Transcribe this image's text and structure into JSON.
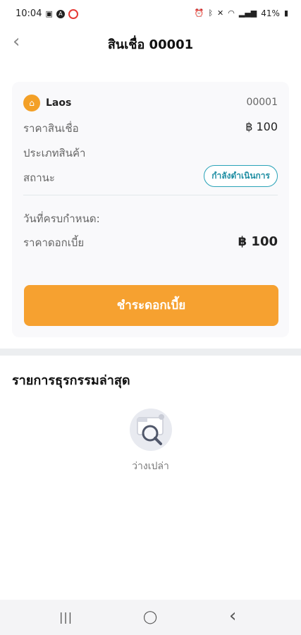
{
  "status_bar": {
    "time": "10:04",
    "battery": "41%"
  },
  "header": {
    "back_glyph": "‹",
    "title": "สินเชื่อ 00001"
  },
  "loan": {
    "provider": "Laos",
    "loan_number": "00001",
    "price_label": "ราคาสินเชื่อ",
    "price_value": "฿ 100",
    "product_type_label": "ประเภทสินค้า",
    "status_label": "สถานะ",
    "status_value": "กำลังดำเนินการ",
    "due_date_label": "วันที่ครบกำหนด:",
    "interest_label": "ราคาดอกเบี้ย",
    "interest_value": "฿ 100",
    "pay_button": "ชำระดอกเบี้ย"
  },
  "transactions": {
    "title": "รายการธุรกรรมล่าสุด",
    "empty_text": "ว่างเปล่า"
  },
  "navbar": {
    "recent_glyph": "|||",
    "home_glyph": "◯",
    "back_glyph": "‹"
  },
  "colors": {
    "accent_orange": "#f6a130",
    "status_teal": "#1f8ea3"
  }
}
